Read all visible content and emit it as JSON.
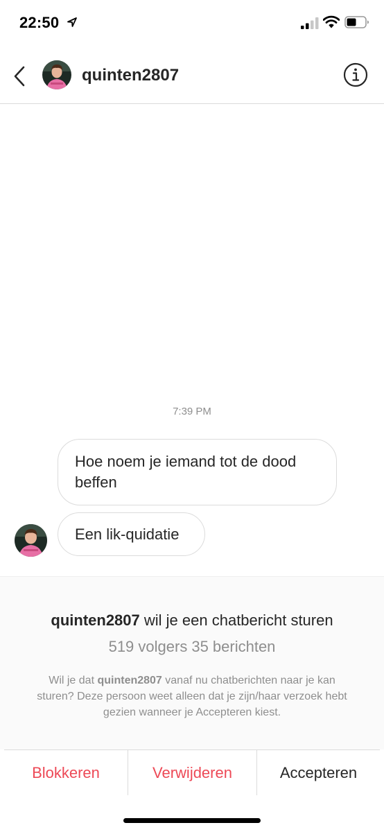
{
  "status_bar": {
    "time": "22:50",
    "icons": [
      "location-arrow-icon",
      "cellular-signal-icon",
      "wifi-icon",
      "battery-icon"
    ]
  },
  "header": {
    "username": "quinten2807",
    "icons": [
      "chevron-left-icon",
      "avatar",
      "info-icon"
    ]
  },
  "chat": {
    "timestamp": "7:39 PM",
    "messages": [
      {
        "text": "Hoe noem je iemand tot de dood beffen"
      },
      {
        "text": "Een lik-quidatie"
      }
    ]
  },
  "request": {
    "username": "quinten2807",
    "title_suffix": "wil je een chatbericht sturen",
    "followers": "519 volgers",
    "posts": "35 berichten",
    "desc_prefix": "Wil je dat",
    "desc_username": "quinten2807",
    "desc_suffix": "vanaf nu chatberichten naar je kan sturen? Deze persoon weet alleen dat je zijn/haar verzoek hebt gezien wanneer je Accepteren kiest."
  },
  "actions": {
    "block": "Blokkeren",
    "delete": "Verwijderen",
    "accept": "Accepteren"
  },
  "colors": {
    "destructive": "#ed4956",
    "text": "#262626",
    "secondary_text": "#8e8e8e",
    "border": "#dbdbdb"
  }
}
